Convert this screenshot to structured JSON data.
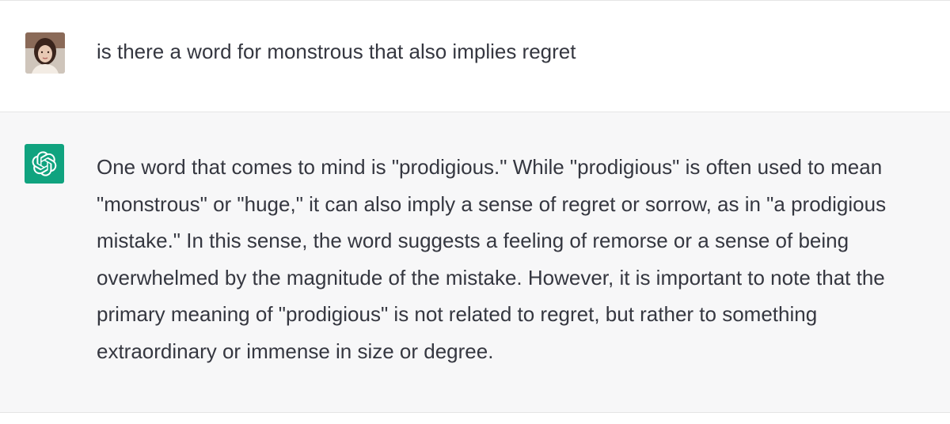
{
  "conversation": {
    "user_message": "is there a word for monstrous that also implies regret",
    "assistant_message": "One word that comes to mind is \"prodigious.\" While \"prodigious\" is often used to mean \"monstrous\" or \"huge,\" it can also imply a sense of regret or sorrow, as in \"a prodigious mistake.\" In this sense, the word suggests a feeling of remorse or a sense of being overwhelmed by the magnitude of the mistake. However, it is important to note that the primary meaning of \"prodigious\" is not related to regret, but rather to something extraordinary or immense in size or degree."
  },
  "icons": {
    "user_avatar": "user-avatar-photo",
    "assistant_avatar": "openai-logo-icon"
  },
  "colors": {
    "assistant_bg": "#f7f7f8",
    "assistant_icon_bg": "#10a37f",
    "text": "#353740",
    "divider": "#e5e5e5"
  }
}
